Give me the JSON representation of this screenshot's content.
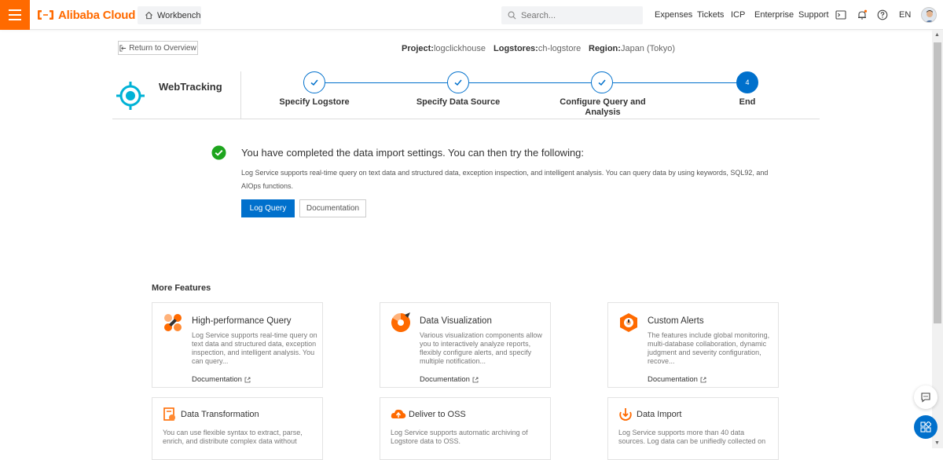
{
  "topbar": {
    "brand": "Alibaba Cloud",
    "workbench": "Workbench",
    "search_placeholder": "Search...",
    "links": [
      "Expenses",
      "Tickets",
      "ICP",
      "Enterprise",
      "Support"
    ],
    "language": "EN",
    "accent": "#ff6a00"
  },
  "header": {
    "return_label": "Return to Overview",
    "project_label": "Project:",
    "project_value": "logclickhouse",
    "logstores_label": "Logstores:",
    "logstores_value": "ch-logstore",
    "region_label": "Region:",
    "region_value": "Japan (Tokyo)"
  },
  "wizard": {
    "title": "WebTracking",
    "steps": [
      {
        "label": "Specify Logstore",
        "status": "done"
      },
      {
        "label": "Specify Data Source",
        "status": "done"
      },
      {
        "label": "Configure Query and Analysis",
        "status": "done"
      },
      {
        "label": "End",
        "status": "active",
        "number": "4"
      }
    ],
    "primary": "#0070cc"
  },
  "success": {
    "title": "You have completed the data import settings. You can then try the following:",
    "desc": "Log Service supports real-time query on text data and structured data, exception inspection, and intelligent analysis. You can query data by using keywords, SQL92, and AIOps functions.",
    "primary_button": "Log Query",
    "secondary_button": "Documentation"
  },
  "features": {
    "title": "More Features",
    "doc_label": "Documentation",
    "cards": [
      {
        "title": "High-performance Query",
        "desc": "Log Service supports real-time query on text data and structured data, exception inspection, and intelligent analysis. You can query...",
        "icon": "query-icon"
      },
      {
        "title": "Data Visualization",
        "desc": "Various visualization components allow you to interactively analyze reports, flexibly configure alerts, and specify multiple notification...",
        "icon": "visualization-icon"
      },
      {
        "title": "Custom Alerts",
        "desc": "The features include global monitoring, multi-database collaboration, dynamic judgment and severity configuration, recove...",
        "icon": "alert-icon"
      },
      {
        "title": "Data Transformation",
        "desc": "You can use flexible syntax to extract, parse, enrich, and distribute complex data without",
        "icon": "transformation-icon"
      },
      {
        "title": "Deliver to OSS",
        "desc": "Log Service supports automatic archiving of Logstore data to OSS.",
        "icon": "oss-icon"
      },
      {
        "title": "Data Import",
        "desc": "Log Service supports more than 40 data sources. Log data can be unifiedly collected on",
        "icon": "import-icon"
      }
    ]
  }
}
